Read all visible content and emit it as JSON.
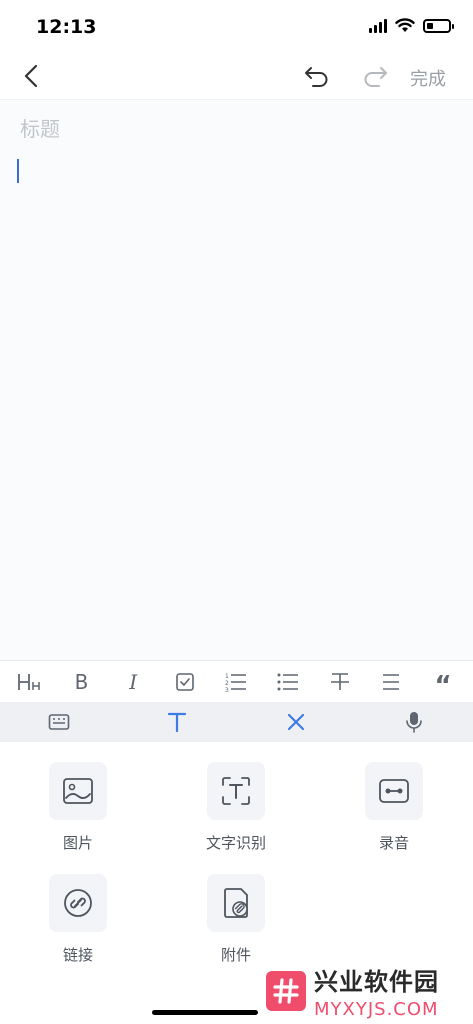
{
  "status_bar": {
    "time": "12:13",
    "battery_level": 0.3
  },
  "nav": {
    "back_icon": "chevron-left-icon",
    "undo_icon": "undo-icon",
    "redo_icon": "redo-icon",
    "done_label": "完成"
  },
  "editor": {
    "title_placeholder": "标题",
    "title_value": "",
    "caret_color": "#3d6bd6"
  },
  "format_toolbar": {
    "items": [
      {
        "name": "heading",
        "icon": "heading-icon",
        "glyph": "H"
      },
      {
        "name": "bold",
        "icon": "bold-icon",
        "glyph": "B"
      },
      {
        "name": "italic",
        "icon": "italic-icon",
        "glyph": "I"
      },
      {
        "name": "checkbox",
        "icon": "checkbox-icon"
      },
      {
        "name": "ordered-list",
        "icon": "ordered-list-icon"
      },
      {
        "name": "bullet-list",
        "icon": "bullet-list-icon"
      },
      {
        "name": "strikethrough",
        "icon": "strikethrough-icon"
      },
      {
        "name": "align",
        "icon": "align-icon"
      },
      {
        "name": "quote",
        "icon": "quote-icon",
        "glyph": "“"
      }
    ]
  },
  "mode_bar": {
    "items": [
      {
        "name": "keyboard",
        "icon": "keyboard-icon"
      },
      {
        "name": "text",
        "icon": "text-format-icon"
      },
      {
        "name": "close",
        "icon": "close-icon"
      },
      {
        "name": "voice",
        "icon": "microphone-icon"
      }
    ],
    "accent": "#3d7be6"
  },
  "insert_panel": {
    "tools": [
      {
        "label": "图片",
        "icon": "image-icon"
      },
      {
        "label": "文字识别",
        "icon": "text-recognition-icon"
      },
      {
        "label": "录音",
        "icon": "recording-icon"
      },
      {
        "label": "链接",
        "icon": "link-icon"
      },
      {
        "label": "附件",
        "icon": "attachment-icon"
      }
    ]
  },
  "watermark": {
    "title": "兴业软件园",
    "subtitle": "MYXYJS.COM",
    "color": "#ef4d6b"
  }
}
